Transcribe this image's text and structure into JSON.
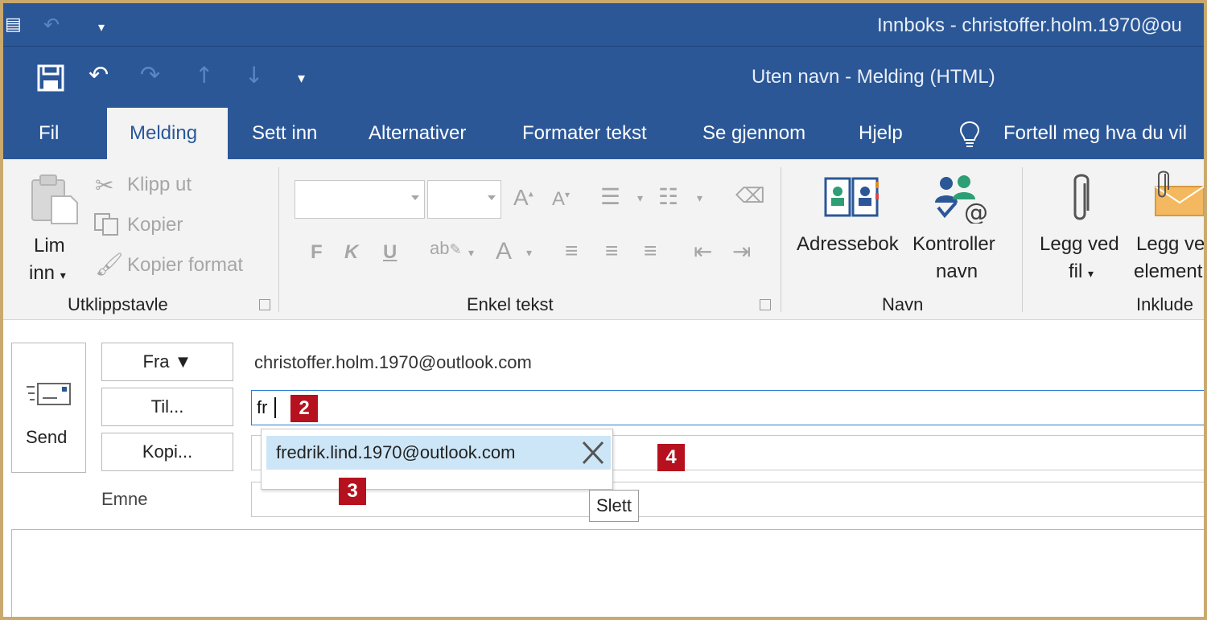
{
  "window": {
    "inbox_title": "Innboks - christoffer.holm.1970@ou",
    "doc_title": "Uten navn  -  Melding (HTML)"
  },
  "tabs": [
    "Fil",
    "Melding",
    "Sett inn",
    "Alternativer",
    "Formater tekst",
    "Se gjennom",
    "Hjelp"
  ],
  "tell_me": "Fortell meg hva du vil",
  "ribbon": {
    "clipboard": {
      "paste_line1": "Lim",
      "paste_line2": "inn",
      "cut": "Klipp ut",
      "copy": "Kopier",
      "format_painter": "Kopier format",
      "label": "Utklippstavle"
    },
    "basic_text": {
      "label": "Enkel tekst",
      "bold": "F",
      "italic": "K",
      "underline": "U"
    },
    "names": {
      "address_book": "Adressebok",
      "check_names_line1": "Kontroller",
      "check_names_line2": "navn",
      "label": "Navn"
    },
    "include": {
      "attach_file_line1": "Legg ved",
      "attach_file_line2": "fil",
      "attach_item_line1": "Legg ve",
      "attach_item_line2": "element",
      "label": "Inklude"
    }
  },
  "compose": {
    "send": "Send",
    "from_button": "Fra",
    "from_value": "christoffer.holm.1970@outlook.com",
    "to_button": "Til...",
    "to_value": "fr",
    "cc_button": "Kopi...",
    "subject_label": "Emne",
    "suggestion": "fredrik.lind.1970@outlook.com",
    "tooltip": "Slett"
  },
  "badges": [
    "2",
    "3",
    "4"
  ],
  "colors": {
    "title_bar": "#2b5797",
    "ribbon_bg": "#f3f3f3",
    "badge": "#b6111e",
    "suggestion_highlight": "#cde6f7"
  }
}
